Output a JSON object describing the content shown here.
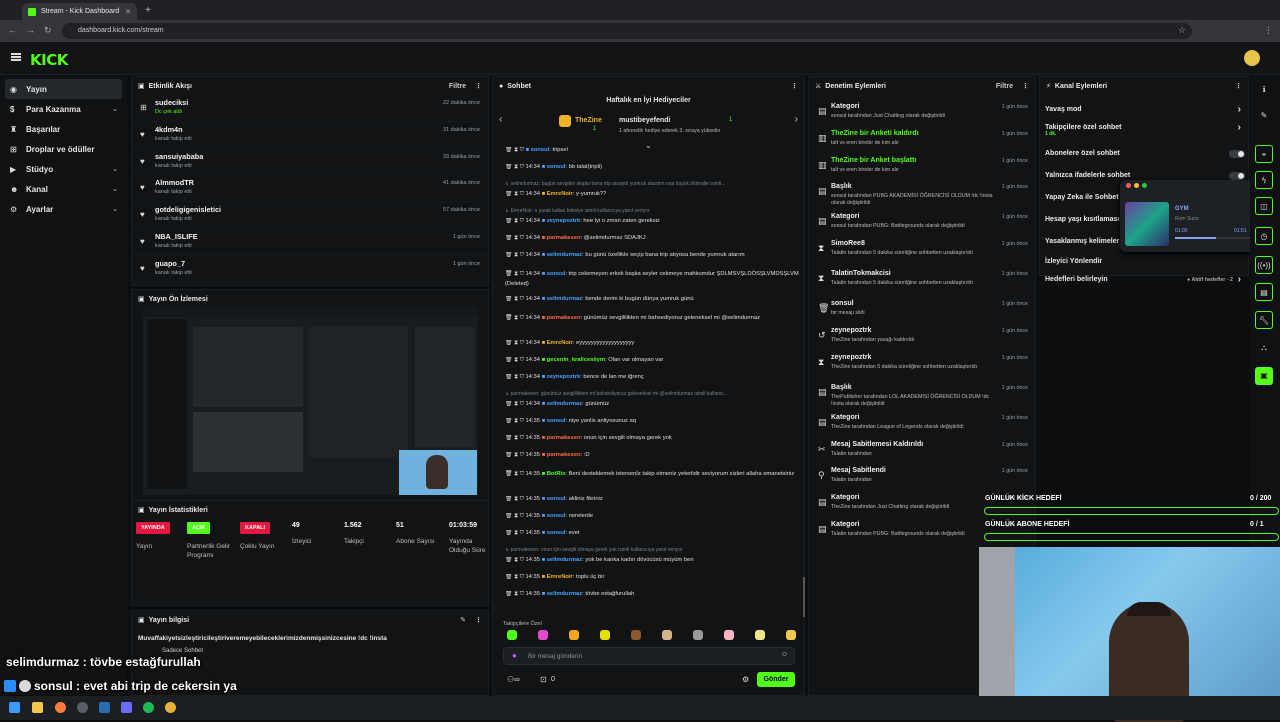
{
  "browser": {
    "tab_title": "Stream - Kick Dashboard",
    "url": "dashboard.kick.com/stream"
  },
  "app": {
    "logo": "KICK"
  },
  "sidebar": {
    "items": [
      {
        "label": "Yayın",
        "icon": "broadcast-icon",
        "active": true,
        "expand": false
      },
      {
        "label": "Para Kazanma",
        "icon": "money-icon",
        "expand": true
      },
      {
        "label": "Başarılar",
        "icon": "trophy-icon",
        "expand": false
      },
      {
        "label": "Droplar ve ödüller",
        "icon": "gift-icon",
        "expand": false
      },
      {
        "label": "Stüdyo",
        "icon": "studio-icon",
        "expand": true
      },
      {
        "label": "Kanal",
        "icon": "user-icon",
        "expand": true
      },
      {
        "label": "Ayarlar",
        "icon": "gear-icon",
        "expand": true
      }
    ]
  },
  "activity": {
    "title": "Etkinlik Akışı",
    "filter": "Filtre",
    "items": [
      {
        "name": "sudeciksi",
        "sub": "Dc çek aldı",
        "sub_green": true,
        "time": "22 dakika önce",
        "icon": "gift-icon"
      },
      {
        "name": "4kdm4n",
        "sub": "kanalı takip etti",
        "time": "31 dakika önce",
        "icon": "heart-icon"
      },
      {
        "name": "sansuiyababa",
        "sub": "kanalı takip etti",
        "time": "33 dakika önce",
        "icon": "heart-icon"
      },
      {
        "name": "AlmmodTR",
        "sub": "kanalı takip etti",
        "time": "41 dakika önce",
        "icon": "heart-icon"
      },
      {
        "name": "gotdeligigenisletici",
        "sub": "kanalı takip etti",
        "time": "57 dakika önce",
        "icon": "heart-icon"
      },
      {
        "name": "NBA_ISLIFE",
        "sub": "kanalı takip etti",
        "time": "1 gün önce",
        "icon": "heart-icon"
      },
      {
        "name": "guapo_7",
        "sub": "kanalı takip etti",
        "time": "1 gün önce",
        "icon": "heart-icon"
      }
    ]
  },
  "preview": {
    "title": "Yayın Ön İzlemesi"
  },
  "stats": {
    "title": "Yayın İstatistikleri",
    "items": [
      {
        "badge": "YAYINDA",
        "badge_color": "#e5173f",
        "label": "Yayın"
      },
      {
        "badge": "AÇIK",
        "badge_color": "#53fc18",
        "label": "Partnerlik Gelir Programı"
      },
      {
        "badge": "KAPALI",
        "badge_color": "#e5173f",
        "label": "Çoklu Yayın"
      },
      {
        "value": "49",
        "label": "İzleyici"
      },
      {
        "value": "1.562",
        "label": "Takipçi"
      },
      {
        "value": "51",
        "label": "Abone Sayısı"
      },
      {
        "value": "01:03:59",
        "label": "Yayında Olduğu Süre"
      }
    ]
  },
  "info": {
    "title": "Yayın bilgisi",
    "stream_title": "Muvaffakiyetsizleştiricileştiriveremeyebileceklerimizdenmişsinizcesine !dc !insta",
    "category": "Sadece Sohbet"
  },
  "chat": {
    "title": "Sohbet",
    "gifters_title": "Haftalık en İyi Hediyeciler",
    "gifter1": "TheZine",
    "gifter1_count": "1",
    "gifter2": "mustibeyefendi",
    "gifter2_count": "1",
    "gifter2_note": "1 abonelik hediye ederek 3. sıraya yükselin",
    "messages": [
      {
        "time": "",
        "user": "sonsul",
        "color": "#4aa3ff",
        "text": "tripsel"
      },
      {
        "time": "14:34",
        "user": "sonsul",
        "color": "#4aa3ff",
        "text": "bb talat(tripli)"
      },
      {
        "reply": "selimdurmaz: bugün sevgilim olupta bana trip atsaydı yumruk atardım ona büyük ihtimalle isimli..."
      },
      {
        "time": "14:34",
        "user": "EmreNoir",
        "color": "#f0b429",
        "text": "y-yumruk??"
      },
      {
        "reply": "EmreNoir: o yarak kafasi bilesiye isimli kullanıcıya yanıt veriyor"
      },
      {
        "time": "14:34",
        "user": "zeynepoztrk",
        "color": "#4aa3ff",
        "text": "hee iyi o zman zaten gereksiz"
      },
      {
        "time": "14:34",
        "user": "parmakesen",
        "color": "#ff6a3d",
        "text": "@selimdurmaz SDAJKJ"
      },
      {
        "time": "14:34",
        "user": "selimdurmaz",
        "color": "#4aa3ff",
        "text": "bu günü özellikle seçip bana trip atıyosa bende yumruk atarım"
      },
      {
        "time": "14:34",
        "user": "sonsul",
        "color": "#4aa3ff",
        "text": "trip cekemeyen erkek başka seyler cekmeye mahkumdur ŞDLMSVŞLDÖSŞLVMDSŞLVM (Deleted)"
      },
      {
        "time": "14:34",
        "user": "selimdurmaz",
        "color": "#4aa3ff",
        "text": "bende derim ki bugün dünya yumruk günü"
      },
      {
        "time": "14:34",
        "user": "parmakesen",
        "color": "#ff6a3d",
        "text": "günümüz sevgililikten mi bahsediyoruz geleneksel mi @selimdurmaz"
      },
      {
        "time": "14:34",
        "user": "EmreNoir",
        "color": "#f0b429",
        "text": "eyyyyyyyyyyyyyyyyyyy"
      },
      {
        "time": "14:34",
        "user": "gecenin_kralicesiiym",
        "color": "#53fc18",
        "text": "Olan var olmayan var"
      },
      {
        "time": "14:34",
        "user": "zeynepoztrk",
        "color": "#4aa3ff",
        "text": "bence de lan me iğrenç"
      },
      {
        "reply": "parmakesen: günümüz sevgililikten mi bahsediyoruz geleneksel mi @selimdurmaz isimli kullanıc..."
      },
      {
        "time": "14:34",
        "user": "selimdurmaz",
        "color": "#4aa3ff",
        "text": "günümüz"
      },
      {
        "time": "14:35",
        "user": "sonsul",
        "color": "#4aa3ff",
        "text": "niye yanlis anliyosunuz aq"
      },
      {
        "time": "14:35",
        "user": "parmakesen",
        "color": "#ff6a3d",
        "text": "onun için sevgili olmaya gerek yok"
      },
      {
        "time": "14:35",
        "user": "parmakesen",
        "color": "#ff6a3d",
        "text": ":D"
      },
      {
        "time": "14:35",
        "user": "BotRix",
        "color": "#53fc18",
        "text": "Beni desteklemek istersenİz takip etmeniz yeterlidir seviyorum sizleri allaha emanetsiniz"
      },
      {
        "time": "14:35",
        "user": "sonsul",
        "color": "#4aa3ff",
        "text": "akliniz fikriniz"
      },
      {
        "time": "14:35",
        "user": "sonsul",
        "color": "#4aa3ff",
        "text": "nerelerde"
      },
      {
        "time": "14:35",
        "user": "sonsul",
        "color": "#4aa3ff",
        "text": "evet"
      },
      {
        "reply": "parmakesen: onun için sevgili olmaya gerek yok isimli kullanıcıya yanıt veriyor"
      },
      {
        "time": "14:35",
        "user": "selimdurmaz",
        "color": "#4aa3ff",
        "text": "yok be kanka kadın dövücüsü müyüm ben"
      },
      {
        "time": "14:35",
        "user": "EmreNoir",
        "color": "#f0b429",
        "text": "toplu üç bir"
      },
      {
        "time": "14:35",
        "user": "selimdurmaz",
        "color": "#4aa3ff",
        "text": "tövbe estağfurullah"
      },
      {
        "time": "14:35",
        "user": "sonsul",
        "color": "#4aa3ff",
        "text": "evet abi trip de cekersin ya"
      }
    ],
    "followers_only": "Takipçilere Özel",
    "input_placeholder": "Bir mesaj gönderin",
    "send": "Gönder",
    "counter": "0"
  },
  "moderation": {
    "title": "Denetim Eylemleri",
    "filter": "Filtre",
    "items": [
      {
        "icon": "category-icon",
        "title": "Kategori",
        "sub": "sonsul tarafından Just Chatting olarak değiştirildi",
        "time": "1 gün önce"
      },
      {
        "icon": "poll-icon",
        "title": "TheZine bir Anketi kaldırdı",
        "sub": "talt vs eren birebir de kim alır",
        "time": "1 gün önce"
      },
      {
        "icon": "poll-icon",
        "title": "TheZine bir Anket başlattı",
        "sub": "talt vs eren birebir de kim alır",
        "time": "1 gün önce"
      },
      {
        "icon": "title-icon",
        "title": "Başlık",
        "sub": "sonsul tarafından PUBG AKADEMİSİ ÖĞRENCİSİ OLDUM !dc !insta olarak değiştirildi",
        "time": "1 gün önce"
      },
      {
        "icon": "category-icon",
        "title": "Kategori",
        "sub": "sonsul tarafından PUBG: Battlegrounds olarak değiştirildi",
        "time": "1 gün önce"
      },
      {
        "icon": "timeout-icon",
        "title": "SimoRee8",
        "sub": "Talatin tarafından 5 dakika süreliğine sohbetten uzaklaştırıldı",
        "time": "1 gün önce"
      },
      {
        "icon": "timeout-icon",
        "title": "TalatinTokmakcisi",
        "sub": "Talatin tarafından 5 dakika süreliğine sohbetten uzaklaştırıldı",
        "time": "1 gün önce"
      },
      {
        "icon": "trash-icon",
        "title": "sonsul",
        "sub": "bir mesajı sildi",
        "time": "1 gün önce"
      },
      {
        "icon": "unban-icon",
        "title": "zeynepoztrk",
        "sub": "TheZine tarafından yasağı kaldırıldı",
        "time": "1 gün önce"
      },
      {
        "icon": "timeout-icon",
        "title": "zeynepoztrk",
        "sub": "TheZine tarafından 5 dakika süreliğine sohbetten uzaklaştırıldı",
        "time": "1 gün önce"
      },
      {
        "icon": "title-icon",
        "title": "Başlık",
        "sub": "ThePublisher tarafından LOL AKADEMİSİ ÖĞRENCİSİ OLDUM !dc !insta olarak değiştirildi",
        "time": "1 gün önce"
      },
      {
        "icon": "category-icon",
        "title": "Kategori",
        "sub": "TheZine tarafından League of Legends olarak değiştirildi",
        "time": "1 gün önce"
      },
      {
        "icon": "unpin-icon",
        "title": "Mesaj Sabitlemesi Kaldırıldı",
        "sub": "Talatin tarafından",
        "time": "1 gün önce"
      },
      {
        "icon": "pin-icon",
        "title": "Mesaj Sabitlendi",
        "sub": "Talatin tarafından",
        "time": "1 gün önce"
      },
      {
        "icon": "category-icon",
        "title": "Kategori",
        "sub": "TheZine tarafından Just Chatting olarak değiştirildi",
        "time": "1 gün önce"
      },
      {
        "icon": "category-icon",
        "title": "Kategori",
        "sub": "Talatin tarafından PUBG: Battlegrounds olarak değiştirildi",
        "time": "1 gün önce"
      }
    ]
  },
  "channel": {
    "title": "Kanal Eylemleri",
    "items": [
      {
        "label": "Yavaş mod",
        "kind": "chevron"
      },
      {
        "label": "Takipçilere özel sohbet",
        "sub": "1 dk.",
        "kind": "chevron"
      },
      {
        "label": "Abonelere özel sohbet",
        "kind": "toggle"
      },
      {
        "label": "Yalnızca ifadelerle sohbet",
        "kind": "toggle"
      },
      {
        "label": "Yapay Zeka ile Sohbet",
        "kind": "none"
      },
      {
        "label": "Hesap yaşı kısıtlaması",
        "kind": "none"
      },
      {
        "label": "Yasaklanmış kelimeler",
        "kind": "none"
      },
      {
        "label": "İzleyici Yönlendir",
        "kind": "none"
      },
      {
        "label": "Hedefleri belirleyin",
        "kind": "chevron",
        "note": "Aktif hedefler - 2"
      }
    ]
  },
  "music": {
    "track": "GYM",
    "artist": "Rom Suno",
    "elapsed": "01:00",
    "total": "01:51"
  },
  "goals": [
    {
      "label": "GÜNLÜK KİCK HEDEFİ",
      "value": "0 / 200"
    },
    {
      "label": "GÜNLÜK ABONE HEDEFİ",
      "value": "0 / 1"
    }
  ],
  "overlay": {
    "line1": "selimdurmaz : tövbe estağfurullah",
    "line2": "sonsul : evet abi trip de cekersin ya"
  }
}
